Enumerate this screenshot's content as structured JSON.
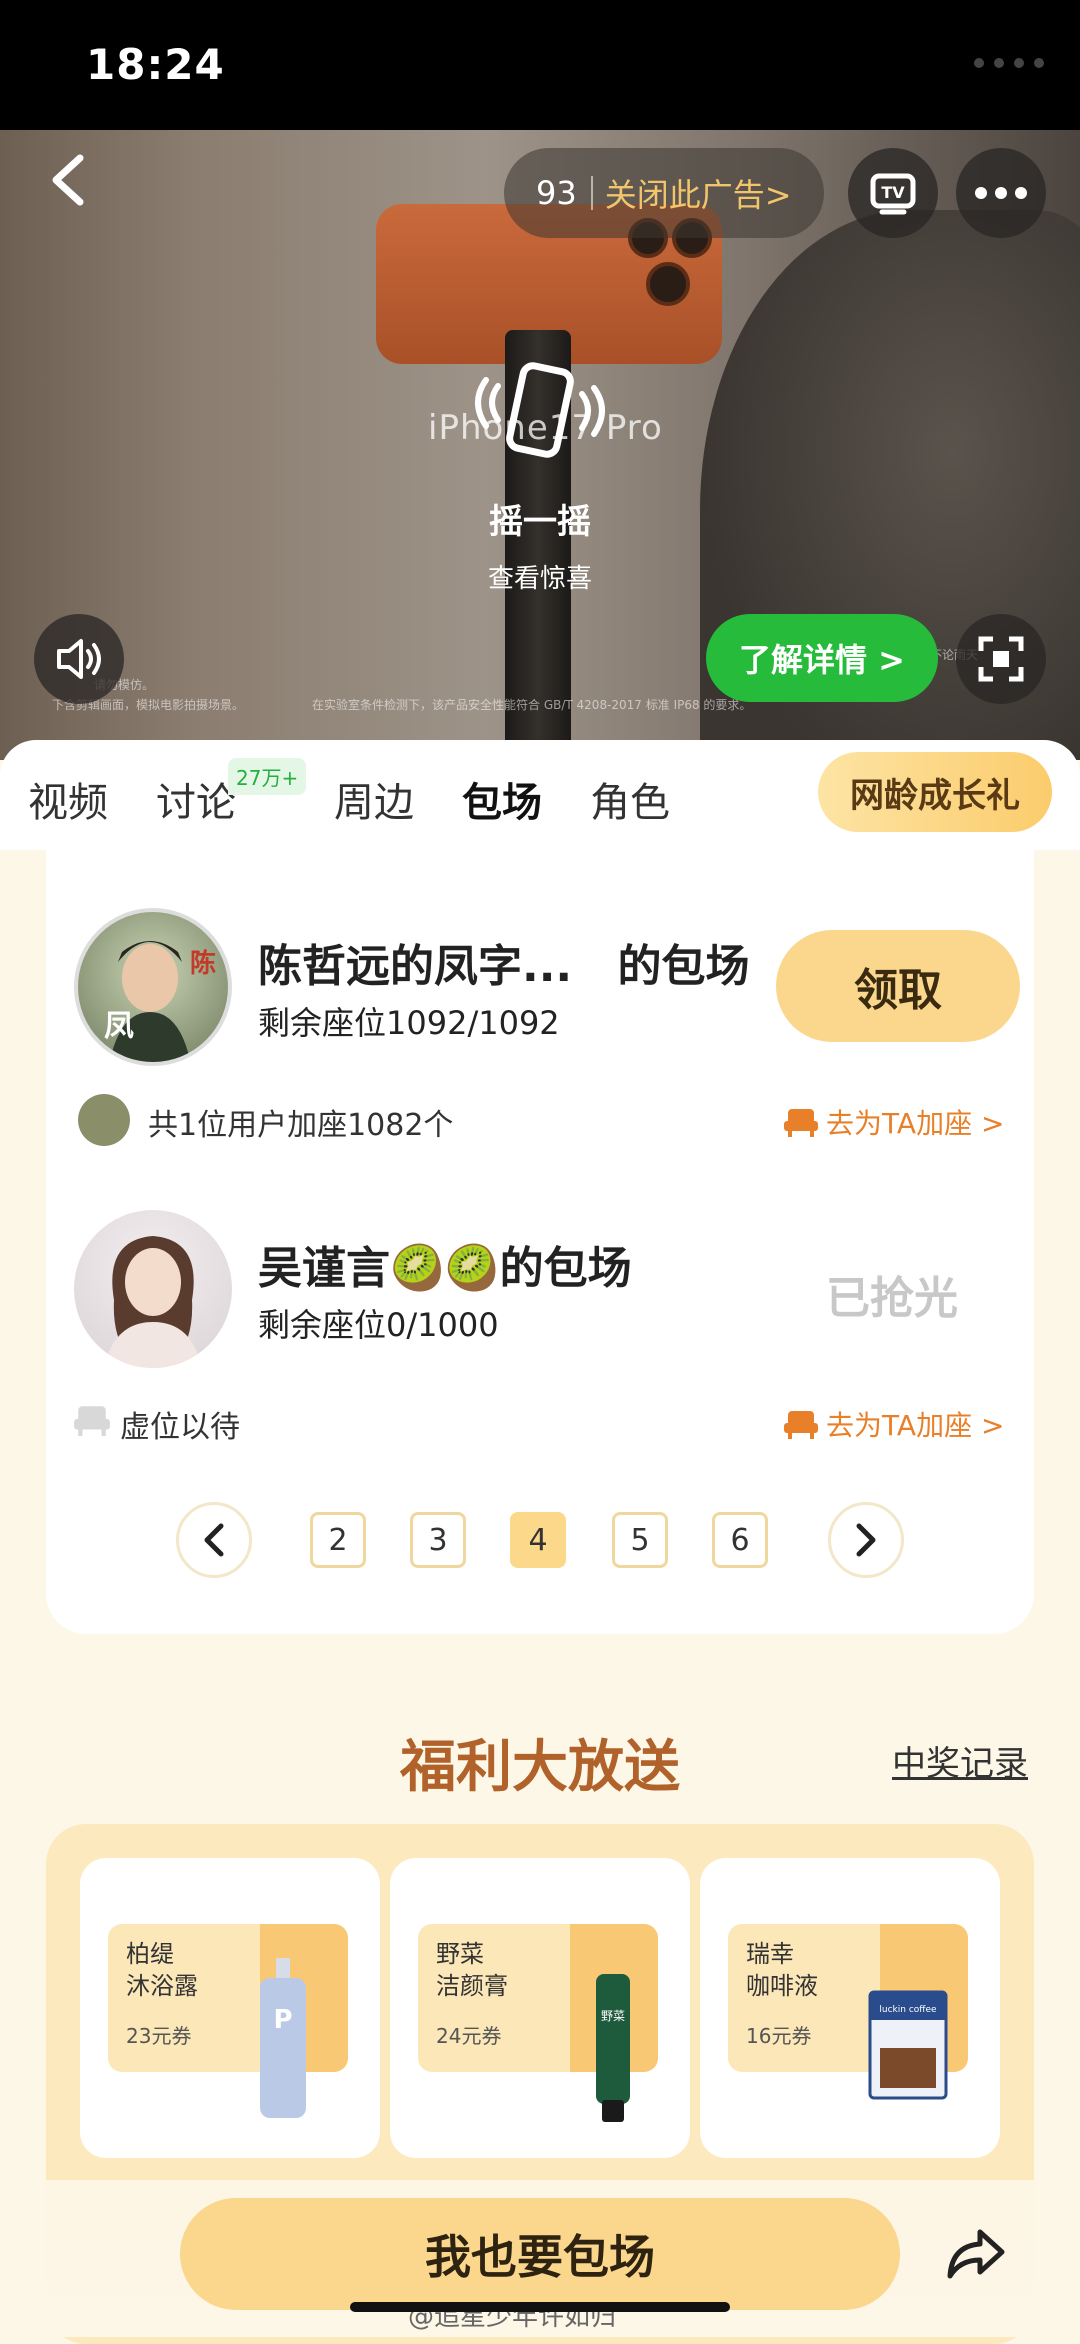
{
  "status_bar": {
    "time": "18:24"
  },
  "ad": {
    "countdown": "93",
    "close_label": "关闭此广告>",
    "product_brand": "iPhone17 Pro",
    "shake_title": "摇一摇",
    "shake_subtitle": "查看惊喜",
    "learn_more_label": "了解详情 >",
    "fine_print_left_1": "请勿模仿。",
    "fine_print_left_2": "下含剪辑画面，模拟电影拍摄场景。",
    "fine_print_mid": "在实验室条件检测下，该产品安全性能符合 GB/T 4208-2017 标准 IP68 的要求。",
    "fine_print_right": "不论雨天"
  },
  "tabs": {
    "items": [
      {
        "label": "视频"
      },
      {
        "label": "讨论"
      },
      {
        "label": "周边"
      },
      {
        "label": "包场"
      },
      {
        "label": "角色"
      }
    ],
    "active": "包场",
    "discussion_badge": "27万+",
    "gift_label": "网龄成长礼"
  },
  "bookings": [
    {
      "title": "陈哲远的凤字...",
      "title_suffix": "的包场",
      "seats": "剩余座位1092/1092",
      "action": "领取",
      "footer_note": "共1位用户加座1082个",
      "footer_link": "去为TA加座 >"
    },
    {
      "title": "吴谨言🥝🥝的包场",
      "seats": "剩余座位0/1000",
      "action": "已抢光",
      "footer_note": "虚位以待",
      "footer_link": "去为TA加座 >"
    }
  ],
  "pager": {
    "pages": [
      "2",
      "3",
      "4",
      "5",
      "6"
    ],
    "current": "4"
  },
  "welfare": {
    "title": "福利大放送",
    "records_label": "中奖记录",
    "prizes": [
      {
        "name_line1": "柏缇",
        "name_line2": "沐浴露",
        "price": "23元券",
        "product_label": "P"
      },
      {
        "name_line1": "野菜",
        "name_line2": "洁颜膏",
        "price": "24元券",
        "product_label": "野菜"
      },
      {
        "name_line1": "瑞幸",
        "name_line2": "咖啡液",
        "price": "16元券",
        "product_label": "luckin coffee"
      }
    ]
  },
  "bottom": {
    "main_button": "我也要包场",
    "watermark": "@追星少年许如归"
  },
  "colors": {
    "accent": "#fbd78e",
    "green": "#27bb3c",
    "orange": "#e8802a",
    "brown_title": "#b0622a"
  }
}
